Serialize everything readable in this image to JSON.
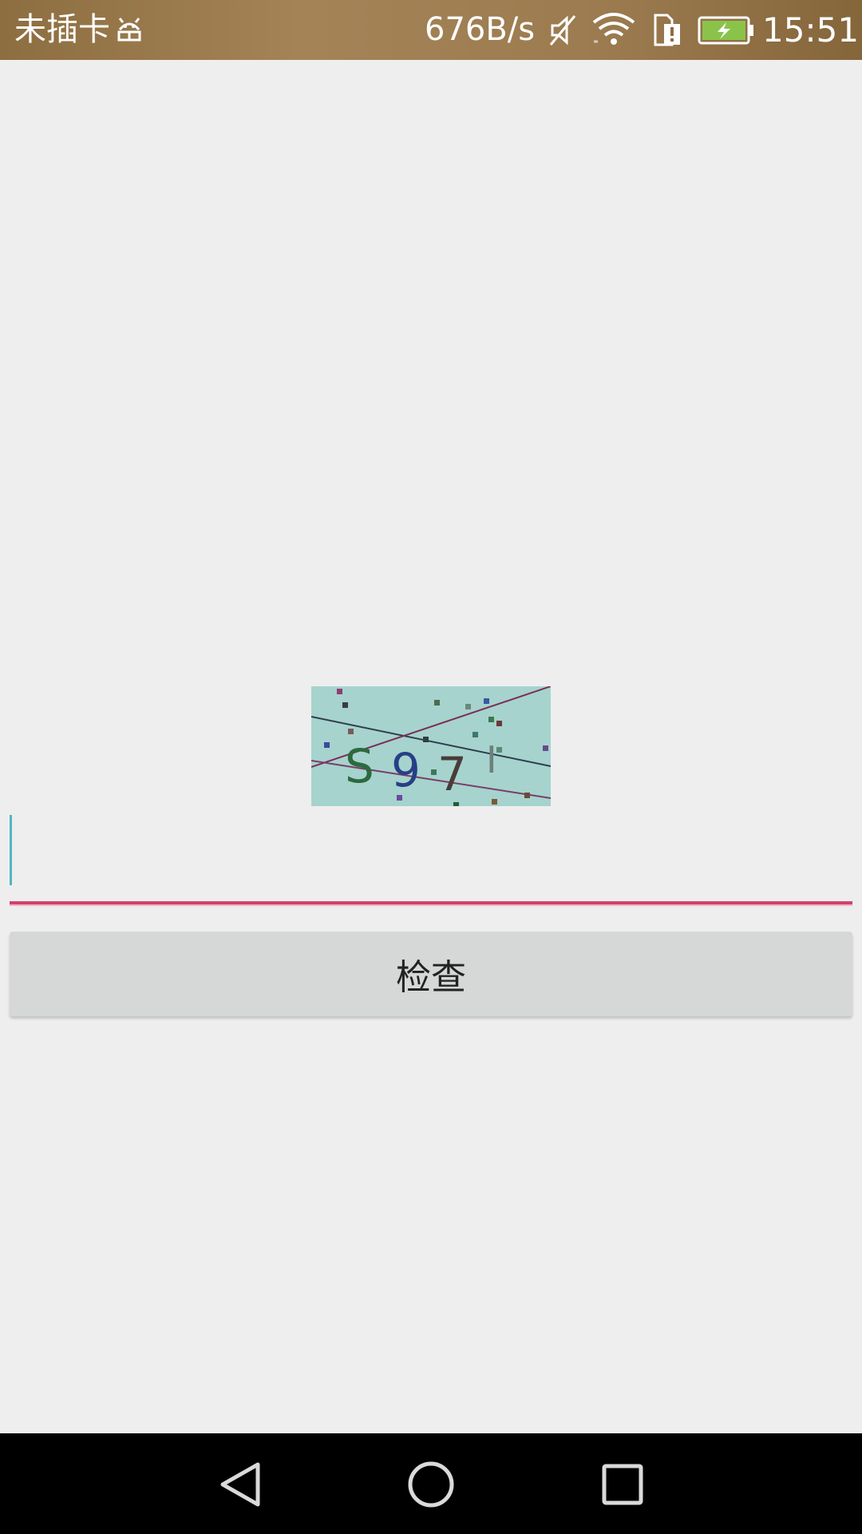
{
  "status_bar": {
    "carrier": "未插卡",
    "network_speed": "676B/s",
    "time": "15:51",
    "icons": [
      "android-debug-icon",
      "mute-icon",
      "wifi-icon",
      "sim-alert-icon",
      "battery-charging-icon"
    ],
    "battery_color": "#8bc34a"
  },
  "captcha": {
    "characters": [
      "S",
      "9",
      "7",
      "I"
    ],
    "background_color": "#a6d3cd"
  },
  "code_input": {
    "value": "",
    "placeholder": "",
    "underline_color": "#d2426e",
    "caret_color": "#4fb8c0"
  },
  "check_button": {
    "label": "检查"
  },
  "nav_bar": {
    "buttons": [
      "back-icon",
      "home-icon",
      "recents-icon"
    ]
  }
}
